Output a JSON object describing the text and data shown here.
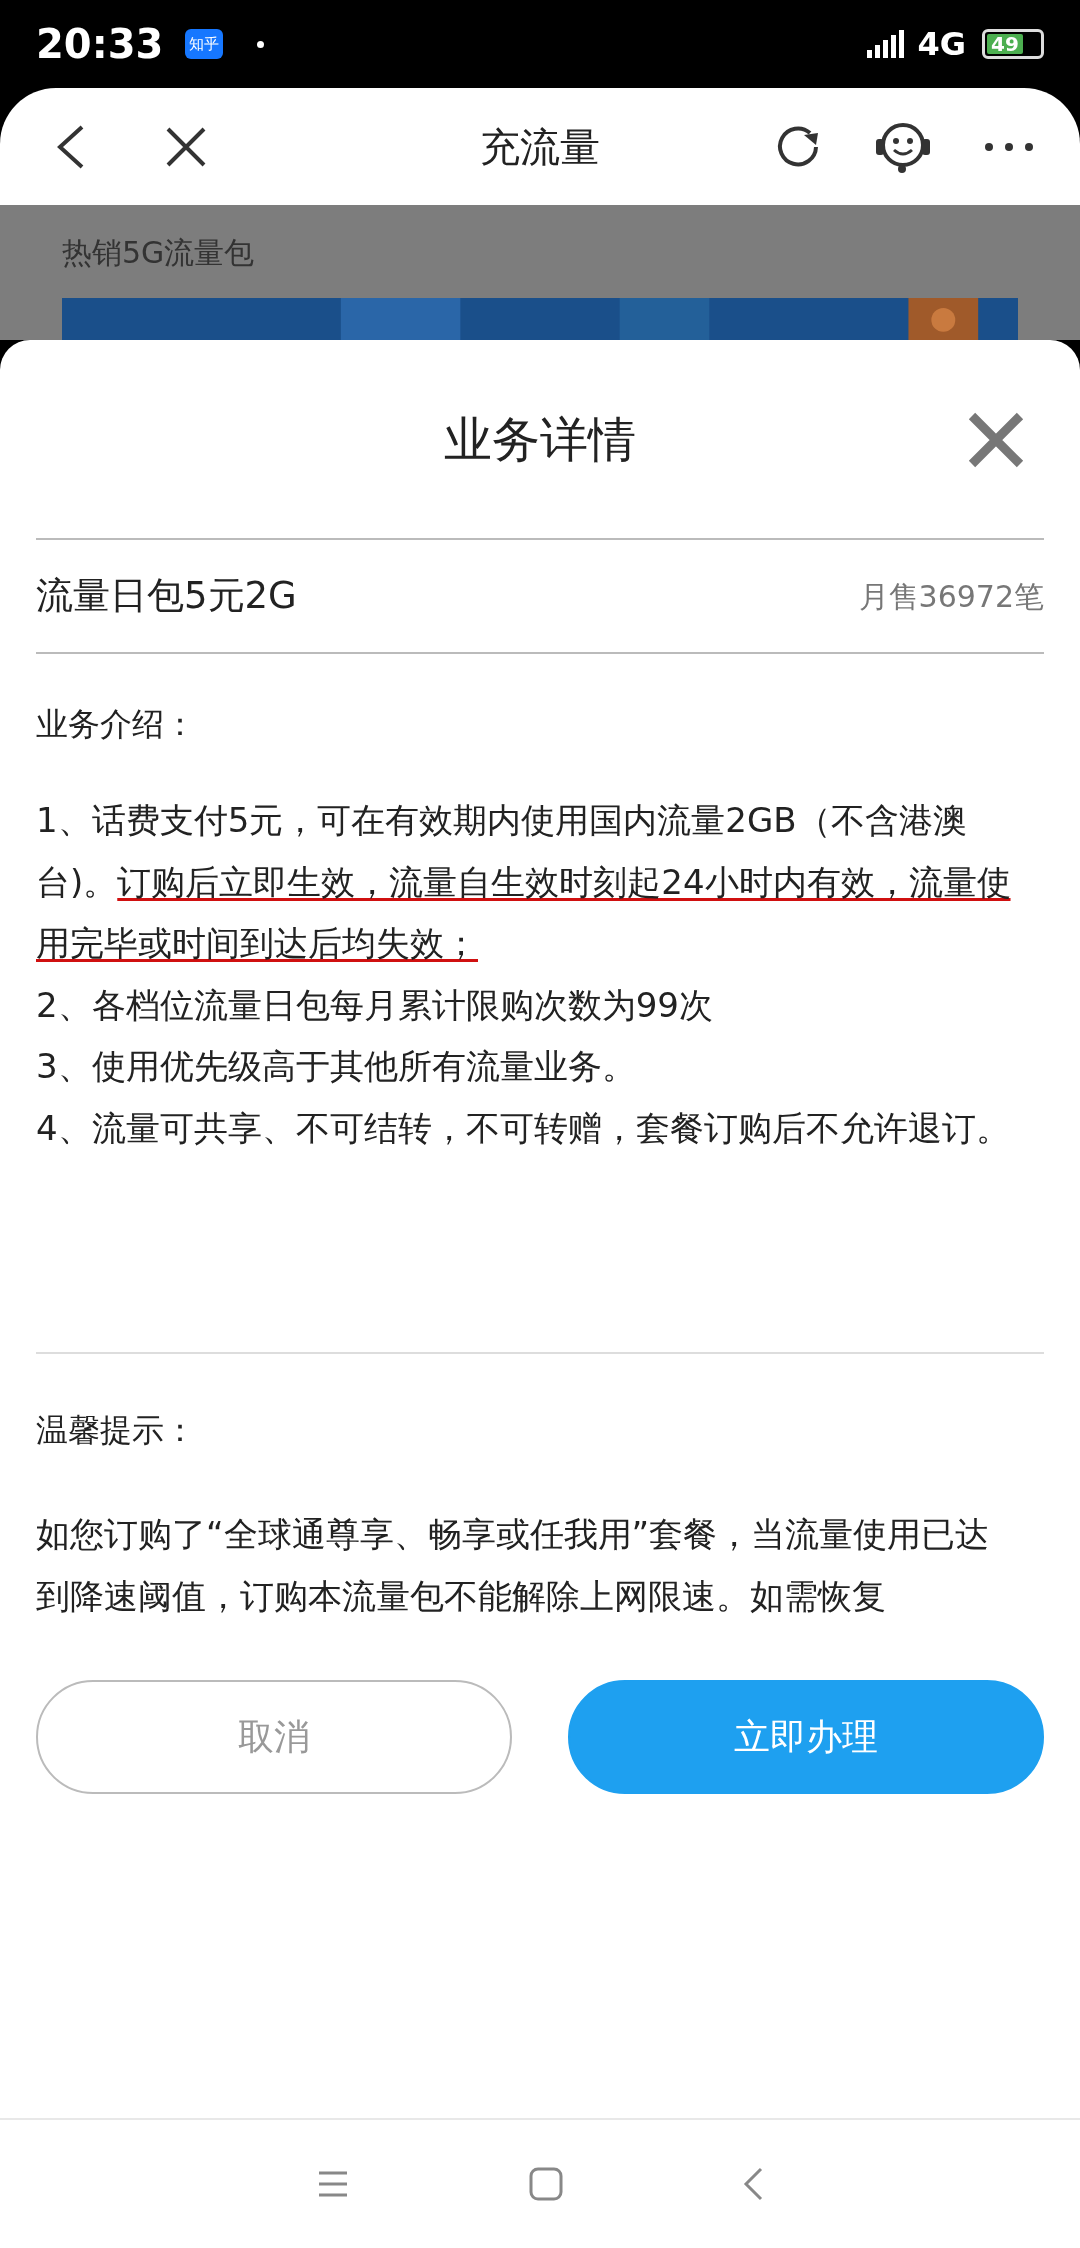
{
  "status_bar": {
    "time": "20:33",
    "app_badge": "知乎",
    "network": "4G",
    "battery": "49"
  },
  "header": {
    "title": "充流量"
  },
  "background_page": {
    "subtitle": "热销5G流量包"
  },
  "sheet": {
    "title": "业务详情",
    "product": {
      "name": "流量日包5元2G",
      "sales": "月售36972笔"
    },
    "intro": {
      "heading": "业务介绍：",
      "items": [
        {
          "segments": [
            {
              "text": "1、话费支付5元，可在有效期内使用国内流量2GB（不含港澳台)。",
              "underlined": false
            },
            {
              "text": "订购后立即生效，流量自生效时刻起24小时内有效，流量使用完毕或时间到达后均失效；",
              "underlined": true
            }
          ]
        },
        {
          "text": "2、各档位流量日包每月累计限购次数为99次"
        },
        {
          "text": "3、使用优先级高于其他所有流量业务。"
        },
        {
          "text": "4、流量可共享、不可结转，不可转赠，套餐订购后不允许退订。"
        }
      ]
    },
    "tips": {
      "heading": "温馨提示：",
      "text": "如您订购了“全球通尊享、畅享或任我用”套餐，当流量使用已达到降速阈值，订购本流量包不能解除上网限速。如需恢复"
    },
    "buttons": [
      {
        "label": "取消",
        "kind": "secondary"
      },
      {
        "label": "立即办理",
        "kind": "primary"
      }
    ]
  }
}
